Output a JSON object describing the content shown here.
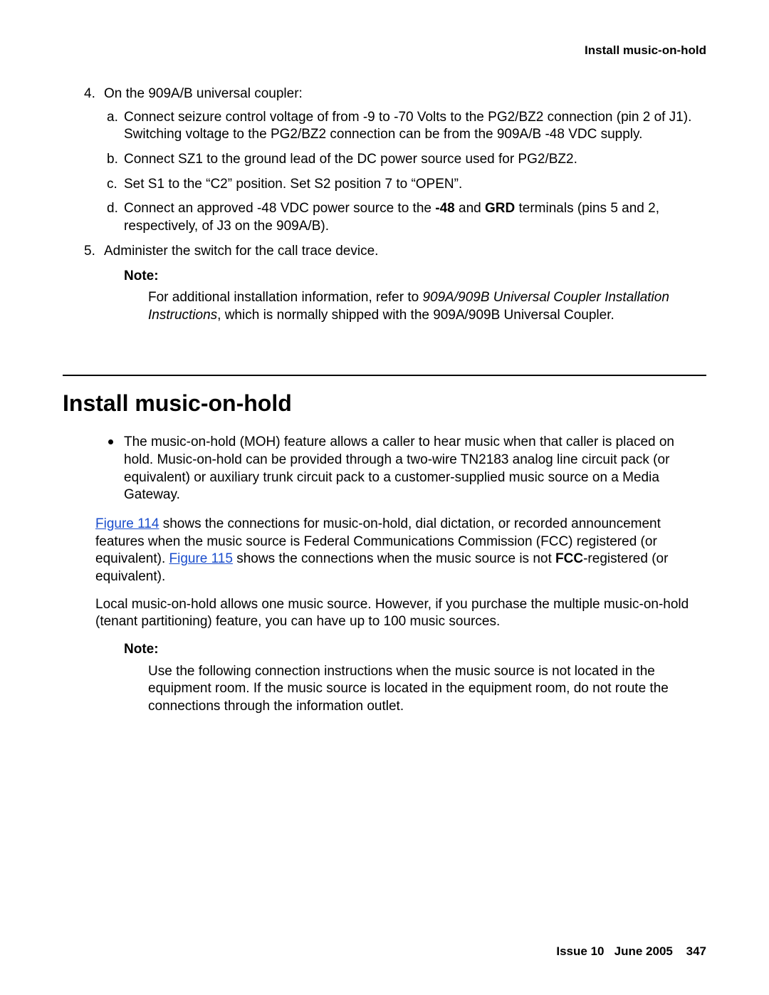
{
  "header": {
    "running_title": "Install music-on-hold"
  },
  "steps": {
    "s4": {
      "marker": "4.",
      "text": "On the 909A/B universal coupler:",
      "sub": {
        "a": {
          "marker": "a.",
          "text": "Connect seizure control voltage of from -9 to -70 Volts to the PG2/BZ2 connection (pin 2 of J1). Switching voltage to the PG2/BZ2 connection can be from the 909A/B -48 VDC supply."
        },
        "b": {
          "marker": "b.",
          "text": "Connect SZ1 to the ground lead of the DC power source used for PG2/BZ2."
        },
        "c": {
          "marker": "c.",
          "text": "Set S1 to the “C2” position. Set S2 position 7 to “OPEN”."
        },
        "d": {
          "marker": "d.",
          "pre": "Connect an approved -48 VDC power source to the ",
          "b1": "-48",
          "mid": " and ",
          "b2": "GRD",
          "post": " terminals (pins 5 and 2, respectively, of J3 on the 909A/B)."
        }
      }
    },
    "s5": {
      "marker": "5.",
      "text": "Administer the switch for the call trace device."
    }
  },
  "note1": {
    "label": "Note:",
    "pre": "For additional installation information, refer to ",
    "italic": "909A/909B Universal Coupler Installation Instructions",
    "post": ", which is normally shipped with the 909A/909B Universal Coupler."
  },
  "section": {
    "title": "Install music-on-hold"
  },
  "bullet1": "The music-on-hold (MOH) feature allows a caller to hear music when that caller is placed on hold. Music-on-hold can be provided through a two-wire TN2183 analog line circuit pack (or equivalent) or auxiliary trunk circuit pack to a customer-supplied music source on a Media Gateway.",
  "p1": {
    "link1": "Figure 114",
    "t1": " shows the connections for music-on-hold, dial dictation, or recorded announcement features when the music source is Federal Communications Commission (FCC) registered (or equivalent). ",
    "link2": "Figure 115",
    "t2": " shows the connections when the music source is not ",
    "b": "FCC",
    "t3": "-registered (or equivalent)."
  },
  "p2": "Local music-on-hold allows one music source. However, if you purchase the multiple music-on-hold (tenant partitioning) feature, you can have up to 100 music sources.",
  "note2": {
    "label": "Note:",
    "text": "Use the following connection instructions when the music source is not located in the equipment room. If the music source is located in the equipment room, do not route the connections through the information outlet."
  },
  "footer": {
    "issue": "Issue 10",
    "date": "June 2005",
    "page": "347"
  }
}
